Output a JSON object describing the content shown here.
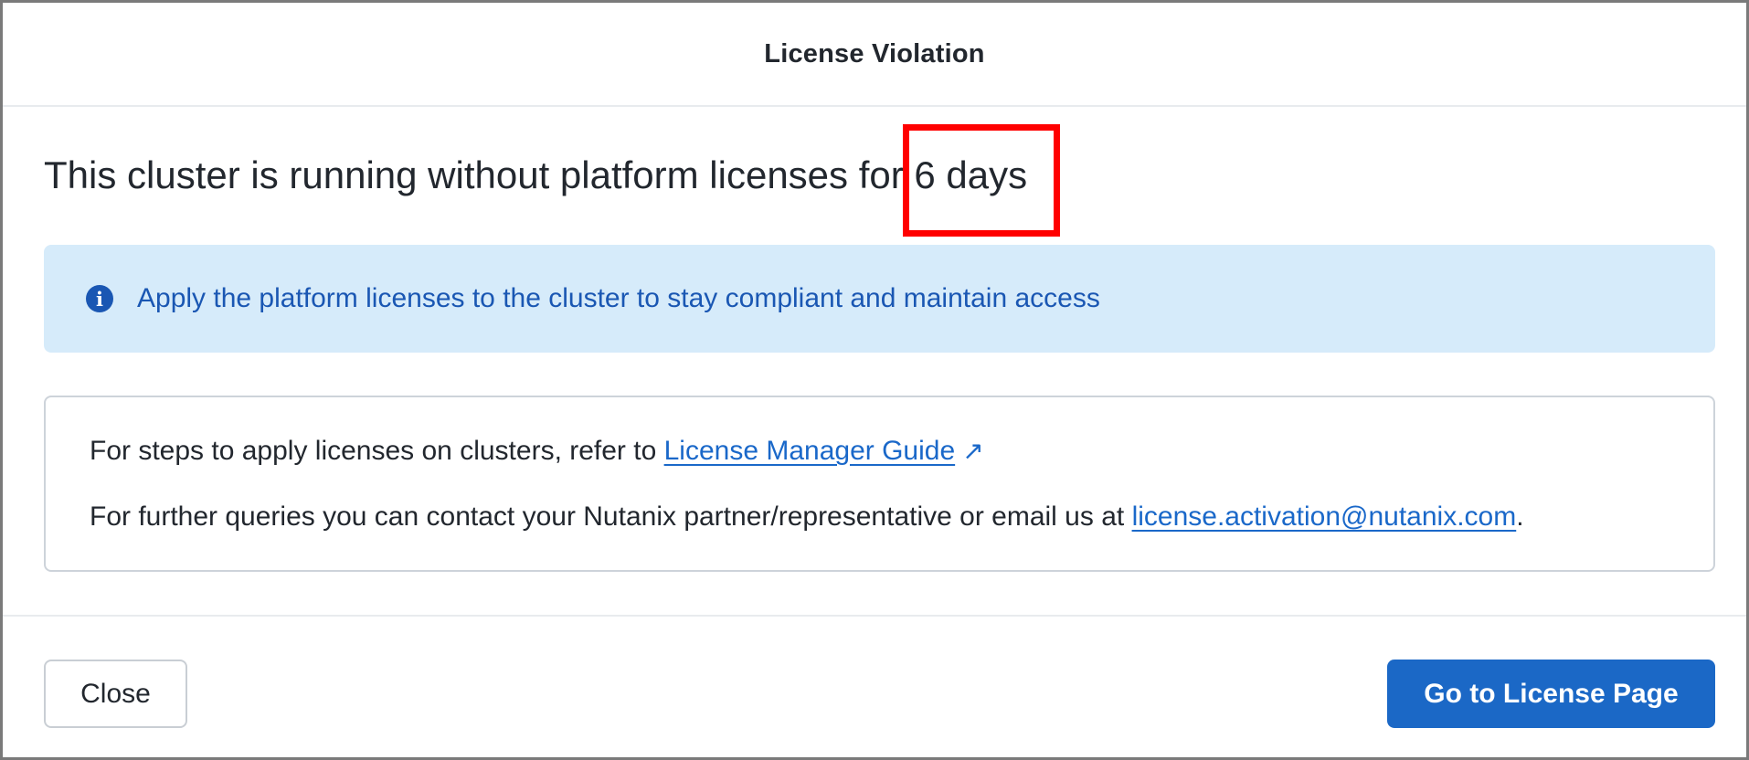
{
  "dialog": {
    "title": "License Violation"
  },
  "headline": {
    "prefix": "This cluster is running without platform licenses for ",
    "days": "6 days"
  },
  "info_banner": {
    "icon": "info-icon",
    "text": "Apply the platform licenses to the cluster to stay compliant and maintain access"
  },
  "guide": {
    "line1_prefix": "For steps to apply licenses on clusters, refer to ",
    "guide_link": "License Manager Guide",
    "external_icon": "↗",
    "line2_prefix": "For further queries you can contact your Nutanix partner/representative or email us at ",
    "email_link": "license.activation@nutanix.com",
    "line2_suffix": "."
  },
  "footer": {
    "close_label": "Close",
    "primary_label": "Go to License Page"
  },
  "colors": {
    "primary": "#1b68c6",
    "banner_bg": "#d6ebfa",
    "banner_text": "#1a57b3",
    "highlight": "#ff0000"
  }
}
